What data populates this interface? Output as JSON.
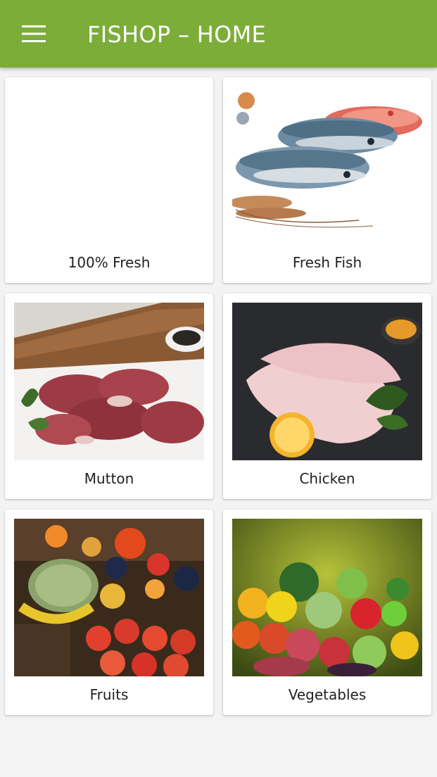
{
  "app": {
    "title": "FISHOP – HOME",
    "menu_icon": "hamburger-menu-icon"
  },
  "colors": {
    "appbar": "#7cad39",
    "background": "#f3f3f3",
    "card": "#ffffff",
    "text": "#222222"
  },
  "categories": [
    {
      "label": "100% Fresh",
      "image": "blank-image"
    },
    {
      "label": "Fresh Fish",
      "image": "fish-photo"
    },
    {
      "label": "Mutton",
      "image": "mutton-photo"
    },
    {
      "label": "Chicken",
      "image": "chicken-photo"
    },
    {
      "label": "Fruits",
      "image": "fruits-photo"
    },
    {
      "label": "Vegetables",
      "image": "vegetables-photo"
    }
  ]
}
